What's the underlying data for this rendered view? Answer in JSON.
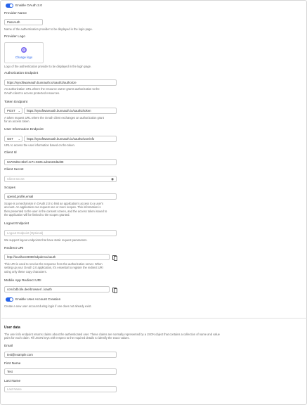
{
  "oauth": {
    "enable_label": "Enable OAuth 2.0",
    "provider_name": {
      "label": "Provider Name",
      "value": "PassAuth",
      "help": "Name of the authentication provider to be displayed in the login page."
    },
    "provider_logo": {
      "label": "Provider Logo",
      "change_label": "Change logo",
      "help": "Logo of the authentication provider to be displayed in the login page."
    },
    "authorization_endpoint": {
      "label": "Authorization Endpoint",
      "value": "https://sysoftwareauth.bunnauth.io/oauth2/authorize",
      "help_line1": "An authorization URL where the resource owner grants authorization to the",
      "help_line2": "OAuth client to access protected resources."
    },
    "token_endpoint": {
      "label": "Token Endpoint",
      "method": "POST",
      "value": "https://sysoftwareauth.bunnauth.io/oauth2/token",
      "help_line1": "A token request URL where the OAuth client exchanges an authorization grant",
      "help_line2": "for an access token."
    },
    "user_info_endpoint": {
      "label": "User Information Endpoint",
      "method": "GET",
      "value": "https://sysoftwareauth.bunnauth.io/oauth2/userinfo",
      "help": "URL to access the user information based on the token."
    },
    "client_id": {
      "label": "Client Id",
      "value": "0a720d94-8b2f-4c71-9225-ad11622d6d39"
    },
    "client_secret": {
      "label": "Client Secret",
      "value": "Client Secret"
    },
    "scopes": {
      "label": "Scopes",
      "value": "openid,profile,email",
      "help_line1": "Scope is a mechanism in OAuth 2.0 to limit an application's access to a user's",
      "help_line2": "account. An application can request one or more scopes. This information is",
      "help_line3": "then presented to the user in the consent screen, and the access token issued to",
      "help_line4": "the application will be limited to the scopes granted."
    },
    "logout_endpoint": {
      "label": "Logout Endpoint",
      "placeholder": "Logout Endpoint (Optional)",
      "help": "We support logout endpoints that have static request parameters."
    },
    "redirect_uri": {
      "label": "Redirect URI",
      "value": "http://localhost:8080/sdpdemo/oauth",
      "help_line1": "This URI is used to receive the response from the authorization server. When",
      "help_line2": "setting up your OAuth 2.0 application, it's essential to register the redirect URI",
      "help_line3": "using only these copy characters."
    },
    "mobile_redirect_uri": {
      "label": "Mobile App Redirect URI",
      "value": "com.bdb.ble.dee/browser/../oauth"
    },
    "enable_user_creation": {
      "label": "Enable User Account Creation",
      "help": "Create a new user account during login if one does not already exist."
    }
  },
  "user_data": {
    "title": "User data",
    "help_line1": "The user info endpoint returns claims about the authenticated user. These claims are normally represented by a JSON object that contains a collection of name and value",
    "help_line2": "pairs for each claim. Fill JSON keys with respect to the required details to identify the exact values.",
    "email": {
      "label": "Email",
      "value": "test@example.com"
    },
    "first_name": {
      "label": "First Name",
      "value": "Test"
    },
    "last_name": {
      "label": "Last Name",
      "placeholder": "Last Name"
    }
  },
  "icons": {
    "eye": "eye-icon",
    "copy": "copy-icon",
    "chevron": "chevron-down-icon",
    "logo": "provider-logo-icon"
  },
  "colors": {
    "accent": "#2563eb",
    "logo": "#7c6cf0"
  }
}
